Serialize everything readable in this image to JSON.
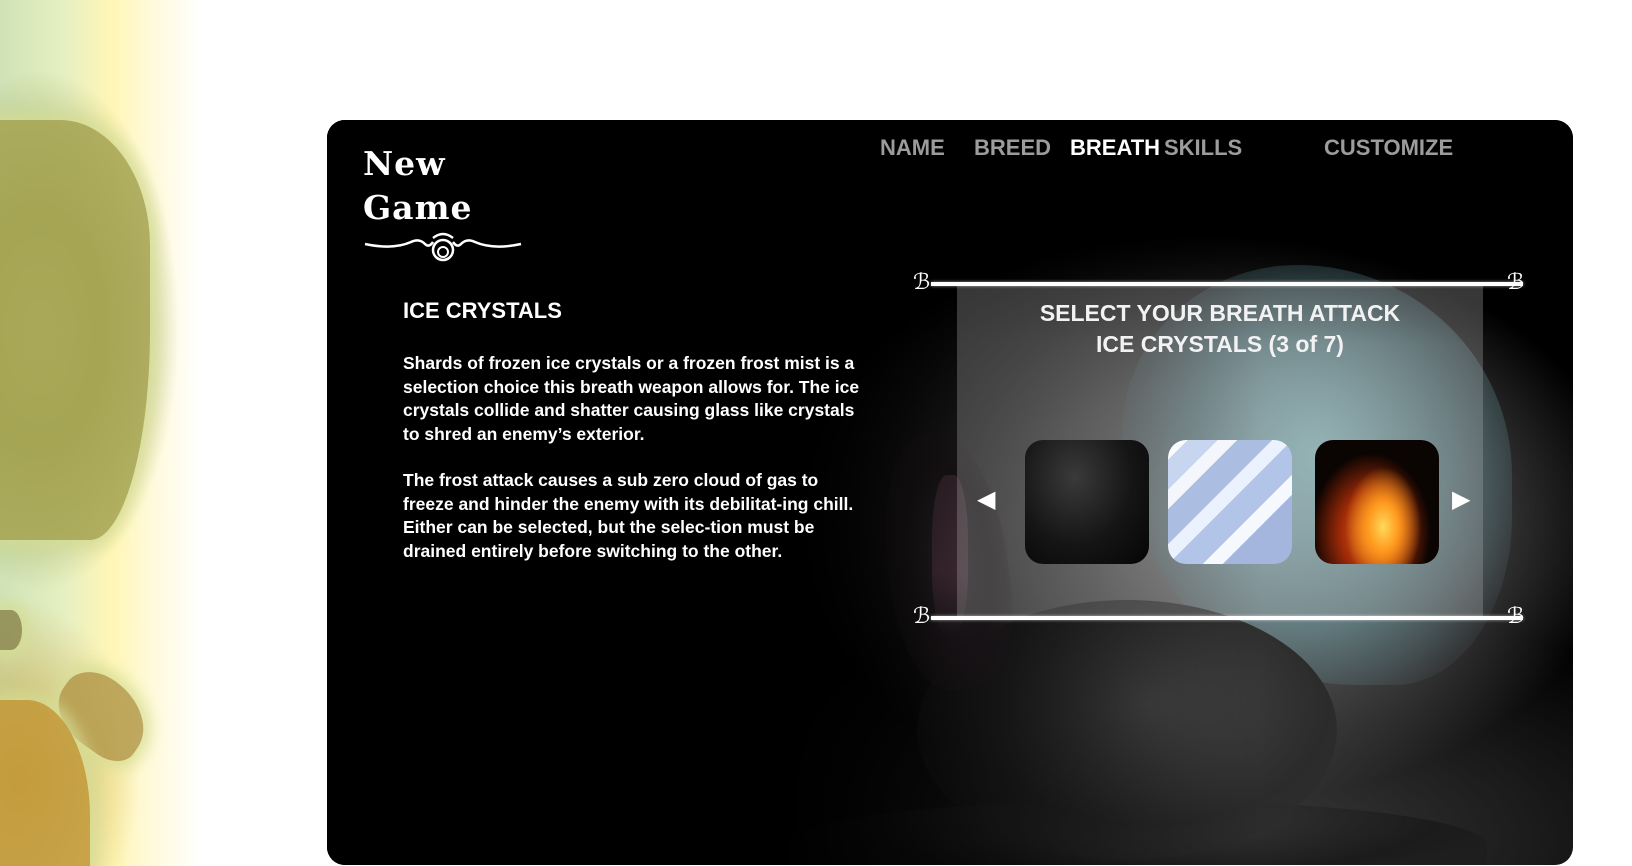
{
  "logo": {
    "text": "New Game"
  },
  "nav": [
    {
      "label": "NAME",
      "active": false
    },
    {
      "label": "BREED",
      "active": false
    },
    {
      "label": "BREATH",
      "active": true
    },
    {
      "label": "SKILLS",
      "active": false
    },
    {
      "label": "CUSTOMIZE",
      "active": false
    }
  ],
  "description": {
    "title": "ICE CRYSTALS",
    "paragraphs": [
      "Shards of frozen ice crystals or a frozen frost mist is a selection choice this breath weapon allows for. The ice crystals collide and shatter causing glass like crystals to shred an enemy’s exterior.",
      "The frost attack causes a sub zero cloud of gas to freeze and hinder the enemy with its debilitat-ing chill. Either can be selected, but the selec-tion must be drained entirely before switching to the other."
    ]
  },
  "selector": {
    "title_line1": "SELECT YOUR BREATH ATTACK",
    "title_line2": "ICE CRYSTALS (3 of 7)",
    "prev_arrow": "◀",
    "next_arrow": "▶",
    "ornament": "ℬ",
    "options": [
      {
        "name": "dark-mist-option",
        "icon": "dark-smoke-thumbnail"
      },
      {
        "name": "ice-crystals-option",
        "icon": "ice-crystals-thumbnail"
      },
      {
        "name": "fire-option",
        "icon": "fire-thumbnail"
      }
    ]
  },
  "colors": {
    "nav_active": "#ffffff",
    "nav_inactive": "#9c9c9c",
    "panel_bg": "#000000"
  }
}
